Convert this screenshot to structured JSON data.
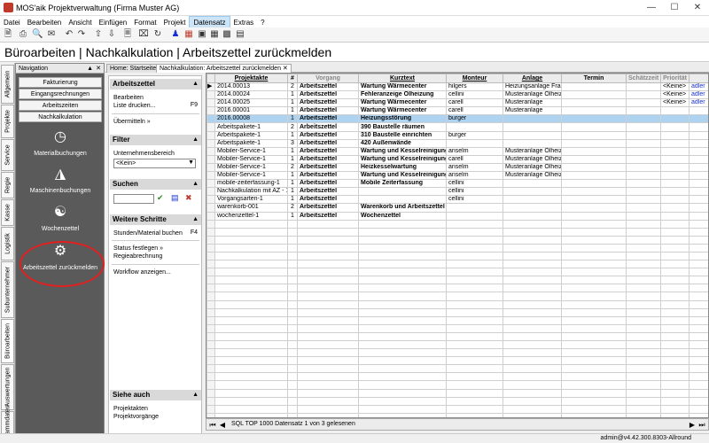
{
  "window": {
    "title": "MOS'aik Projektverwaltung (Firma Muster AG)"
  },
  "menu": [
    "Datei",
    "Bearbeiten",
    "Ansicht",
    "Einfügen",
    "Format",
    "Projekt",
    "Datensatz",
    "Extras",
    "?"
  ],
  "menu_active": "Datensatz",
  "page": {
    "title": "Büroarbeiten | Nachkalkulation | Arbeitszettel zurückmelden"
  },
  "left_tabs": [
    "Allgemein",
    "Projekte",
    "Service",
    "Regie",
    "Kasse",
    "Logistik",
    "Subunternehmer",
    "Büroarbeiten",
    "Auswertungen",
    "Stammdaten"
  ],
  "navigation": {
    "title": "Navigation",
    "buttons": [
      "Fakturierung",
      "Eingangsrechnungen",
      "Arbeitszeiten",
      "Nachkalkulation"
    ],
    "icons": [
      {
        "label": "Materialbuchungen",
        "icon": "clock-icon"
      },
      {
        "label": "Maschinenbuchungen",
        "icon": "database-icon"
      },
      {
        "label": "Wochenzettel",
        "icon": "money-icon"
      },
      {
        "label": "Arbeitszettel zurückmelden",
        "icon": "document-gear-icon"
      }
    ]
  },
  "doc_tabs": [
    "Home: Startseite",
    "Nachkalkulation: Arbeitszettel zurückmelden"
  ],
  "taskpane": {
    "section1": {
      "title": "Arbeitszettel",
      "item1": "Bearbeiten",
      "item2": "Liste drucken...",
      "item2_key": "F9",
      "item3": "Übermitteln »"
    },
    "filter": {
      "title": "Filter",
      "label": "Unternehmensbereich",
      "value": "<Kein>"
    },
    "search": {
      "title": "Suchen",
      "placeholder": ""
    },
    "steps": {
      "title": "Weitere Schritte",
      "item1": "Stunden/Material buchen",
      "item1_key": "F4",
      "item2": "Status festlegen »",
      "item3": "Regieabrechnung",
      "item4": "Workflow anzeigen..."
    },
    "seealso": {
      "title": "Siehe auch",
      "item1": "Projektakten",
      "item2": "Projektvorgänge"
    }
  },
  "table": {
    "columns": [
      "Projektakte",
      "#",
      "Vorgang",
      "Kurztext",
      "Monteur",
      "Anlage",
      "Termin",
      "Schätzzeit",
      "Priorität"
    ],
    "rows": [
      [
        "2014.00013",
        "2",
        "Arbeitszettel",
        "Wartung Wärmecenter",
        "hilgers",
        "Heizungsanlage Frar",
        "",
        "",
        "<Keine>",
        "adler"
      ],
      [
        "2014.00024",
        "1",
        "Arbeitszettel",
        "Fehleranzeige Ölheizung",
        "cellini",
        "Musteranlage Ölheiz",
        "",
        "",
        "<Keine>",
        "adler"
      ],
      [
        "2014.00025",
        "1",
        "Arbeitszettel",
        "Wartung Wärmecenter",
        "carell",
        "Musteranlage",
        "",
        "",
        "<Keine>",
        "adler"
      ],
      [
        "2016.00001",
        "1",
        "Arbeitszettel",
        "Wartung Wärmecenter",
        "carell",
        "Musteranlage",
        "",
        "",
        "",
        ""
      ],
      [
        "2016.00008",
        "1",
        "Arbeitszettel",
        "Heizungsstörung",
        "burger",
        "",
        "",
        "",
        "",
        ""
      ],
      [
        "Arbeitspakete-1",
        "2",
        "Arbeitszettel",
        "390 Baustelle räumen",
        "",
        "",
        "",
        "",
        "",
        ""
      ],
      [
        "Arbeitspakete-1",
        "1",
        "Arbeitszettel",
        "310 Baustelle einrichten",
        "burger",
        "",
        "",
        "",
        "",
        ""
      ],
      [
        "Arbeitspakete-1",
        "3",
        "Arbeitszettel",
        "420 Außenwände",
        "",
        "",
        "",
        "",
        "",
        ""
      ],
      [
        "Mobiler-Service-1",
        "1",
        "Arbeitszettel",
        "Wartung und Kesselreinigung",
        "anselm",
        "Musteranlage Ölheiz",
        "",
        "",
        "",
        ""
      ],
      [
        "Mobiler-Service-1",
        "1",
        "Arbeitszettel",
        "Wartung und Kesselreinigung",
        "carell",
        "Musteranlage Ölheiz",
        "",
        "",
        "",
        ""
      ],
      [
        "Mobiler-Service-1",
        "2",
        "Arbeitszettel",
        "Heizkesselwartung",
        "anselm",
        "Musteranlage Ölheiz",
        "",
        "",
        "",
        ""
      ],
      [
        "Mobiler-Service-1",
        "1",
        "Arbeitszettel",
        "Wartung und Kesselreinigung",
        "anselm",
        "Musteranlage Ölheiz",
        "",
        "",
        "",
        ""
      ],
      [
        "mobile-zeiterfassung-1",
        "1",
        "Arbeitszettel",
        "Mobile Zeiterfassung",
        "cellini",
        "",
        "",
        "",
        "",
        ""
      ],
      [
        "Nachkalkulation mit AZ - 1",
        "1",
        "Arbeitszettel",
        "",
        "cellini",
        "",
        "",
        "",
        "",
        ""
      ],
      [
        "Vorgangsarten-1",
        "1",
        "Arbeitszettel",
        "",
        "cellini",
        "",
        "",
        "",
        "",
        ""
      ],
      [
        "warenkorb-001",
        "2",
        "Arbeitszettel",
        "Warenkorb und Arbeitszettel",
        "",
        "",
        "",
        "",
        "",
        ""
      ],
      [
        "wochenzettel-1",
        "1",
        "Arbeitszettel",
        "Wochenzettel",
        "",
        "",
        "",
        "",
        "",
        ""
      ]
    ],
    "selected_row": 4
  },
  "status": {
    "text": "SQL TOP 1000 Datensatz 1 von 3 gelesenen",
    "user": "admin@v4.42.300.8303-Allround"
  }
}
